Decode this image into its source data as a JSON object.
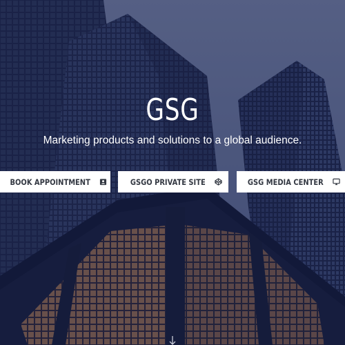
{
  "hero": {
    "title": "GSG",
    "subtitle": "Marketing products and solutions to a global audience."
  },
  "buttons": [
    {
      "label": "BOOK APPOINTMENT",
      "icon": "calendar-user-icon"
    },
    {
      "label": "GSGO PRIVATE SITE",
      "icon": "codepen-cube-icon"
    },
    {
      "label": "GSG MEDIA CENTER",
      "icon": "monitor-play-icon"
    }
  ],
  "scroll_indicator": {
    "icon": "arrow-down-icon"
  },
  "colors": {
    "sky": "#5a6588",
    "building": "#1b2245",
    "button_bg": "#ffffff",
    "button_text": "#333842",
    "window_warm": "#b98456"
  }
}
